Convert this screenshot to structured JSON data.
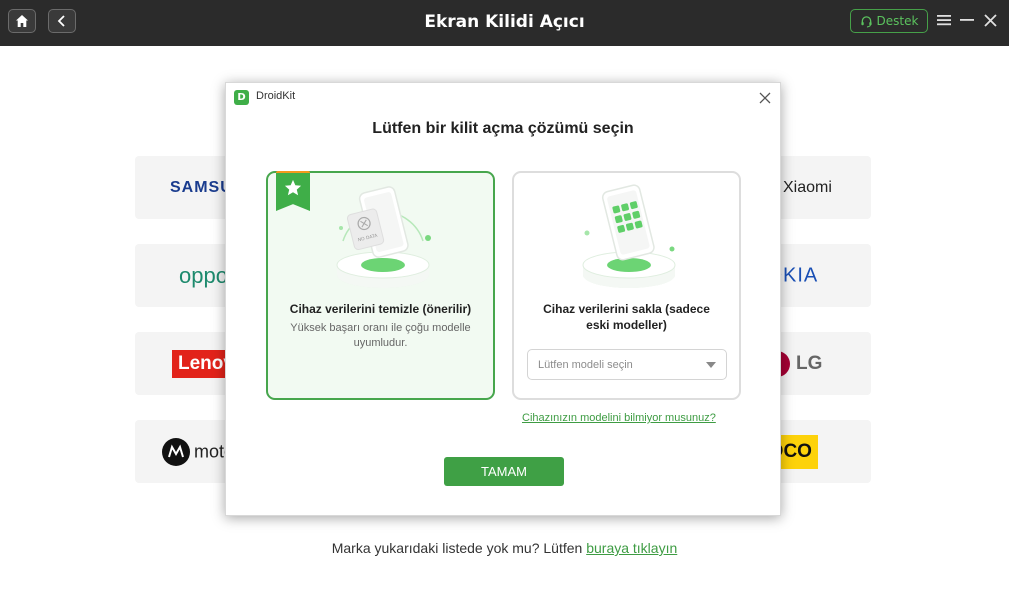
{
  "titlebar": {
    "title": "Ekran Kilidi Açıcı",
    "support_label": "Destek",
    "icons": [
      "home-icon",
      "back-icon",
      "headset-icon",
      "menu-icon",
      "minimize-icon",
      "close-icon"
    ]
  },
  "brands": {
    "left": [
      "SAMSUNG",
      "oppo",
      "Lenovo",
      "motorola"
    ],
    "right": [
      "Xiaomi",
      "NOKIA",
      "LG",
      "POCO"
    ]
  },
  "bottom": {
    "text": "Marka yukarıdaki listede yok mu? Lütfen",
    "link": "buraya tıklayın"
  },
  "modal": {
    "app_name": "DroidKit",
    "logo_letter": "D",
    "heading": "Lütfen bir kilit açma çözümü seçin",
    "options": [
      {
        "title": "Cihaz verilerini temizle (önerilir)",
        "description": "Yüksek başarı oranı ile çoğu modelle uyumludur.",
        "illustration_text": "NO DATA",
        "selected": true
      },
      {
        "title": "Cihaz verilerini sakla (sadece eski modeller)",
        "select_placeholder": "Lütfen modeli seçin",
        "selected": false
      }
    ],
    "unknown_model_link": "Cihazınızın modelini bilmiyor musunuz?",
    "ok_label": "TAMAM"
  },
  "colors": {
    "accent": "#3fae48",
    "titlebar_bg": "#2b2b2b",
    "badge_orange": "#f39a1d"
  }
}
